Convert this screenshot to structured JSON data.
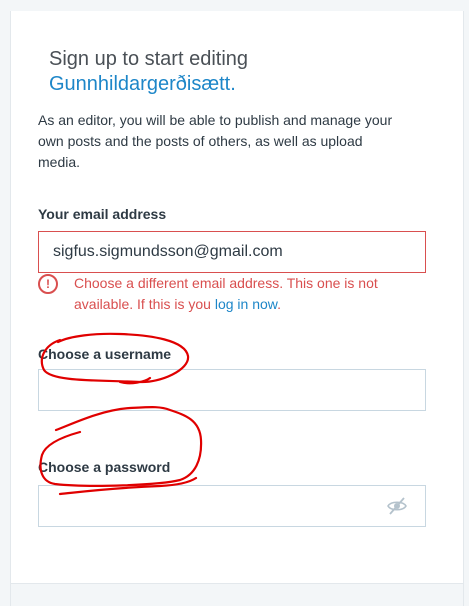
{
  "signup": {
    "heading_line1": "Sign up to start editing",
    "site_name": "Gunnhildargerðisætt.",
    "intro": "As an editor, you will be able to publish and manage your own posts and the posts of others, as well as upload media."
  },
  "email": {
    "label": "Your email address",
    "value": "sigfus.sigmundsson@gmail.com",
    "error_icon": "!",
    "error_text": "Choose a different email address. This one is not available. If this is you ",
    "error_link": "log in now",
    "error_end": "."
  },
  "username": {
    "label": "Choose a username",
    "value": ""
  },
  "password": {
    "label": "Choose a password",
    "value": "",
    "toggle_icon": "eye-slash-icon"
  },
  "colors": {
    "accent": "#1d86c8",
    "error": "#d94f4f",
    "annotation": "#e00000"
  }
}
